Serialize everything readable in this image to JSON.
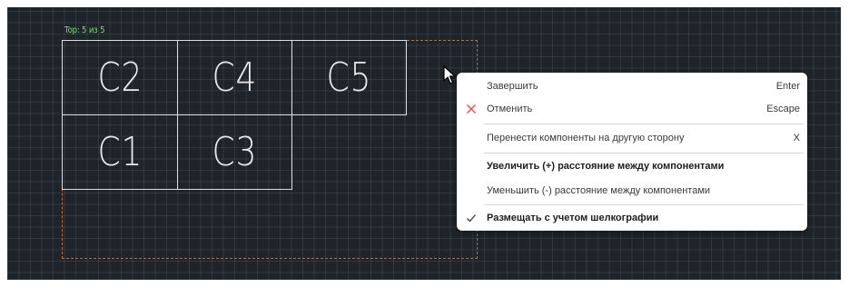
{
  "canvas": {
    "counter": "Top: 5 из 5",
    "components": [
      {
        "ref": "C2"
      },
      {
        "ref": "C4"
      },
      {
        "ref": "C5"
      },
      {
        "ref": "C1"
      },
      {
        "ref": "C3"
      }
    ]
  },
  "context_menu": {
    "items": [
      {
        "label": "Завершить",
        "shortcut": "Enter"
      },
      {
        "label": "Отменить",
        "shortcut": "Escape",
        "icon": "close-icon"
      },
      {
        "label": "Перенести компоненты на другую сторону",
        "shortcut": "X"
      },
      {
        "label": "Увеличить (+) расстояние между компонентами"
      },
      {
        "label": "Уменьшить (-) расстояние между компонентами"
      },
      {
        "label": "Размещать с учетом шелкографии",
        "icon": "check-icon"
      }
    ]
  },
  "colors": {
    "canvas_bg": "#1f242b",
    "counter_text": "#6fe06f",
    "selection_border": "#c56a2a",
    "cancel_icon": "#e04848"
  }
}
